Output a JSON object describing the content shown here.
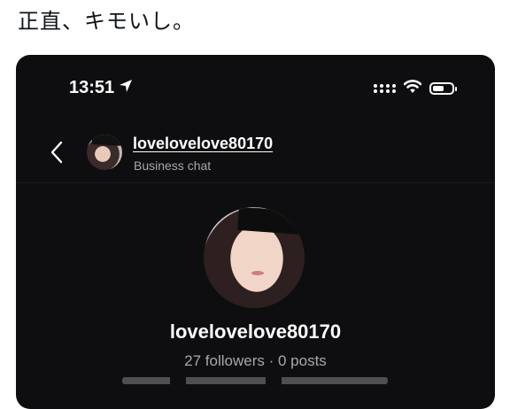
{
  "tweet": {
    "text": "正直、キモいし。"
  },
  "status_bar": {
    "time": "13:51",
    "location_icon": "location-arrow-icon",
    "signal_icon": "signal-dots-icon",
    "wifi_icon": "wifi-icon",
    "battery_icon": "battery-icon",
    "battery_level": 0.6
  },
  "header": {
    "back_icon": "chevron-left-icon",
    "username": "lovelovelove80170",
    "subtitle": "Business chat"
  },
  "profile": {
    "username": "lovelovelove80170",
    "stats": "27 followers · 0 posts"
  },
  "colors": {
    "screen_background": "#0e0e10",
    "primary_text": "#ffffff",
    "secondary_text": "#a8a8ad",
    "page_background": "#ffffff"
  }
}
